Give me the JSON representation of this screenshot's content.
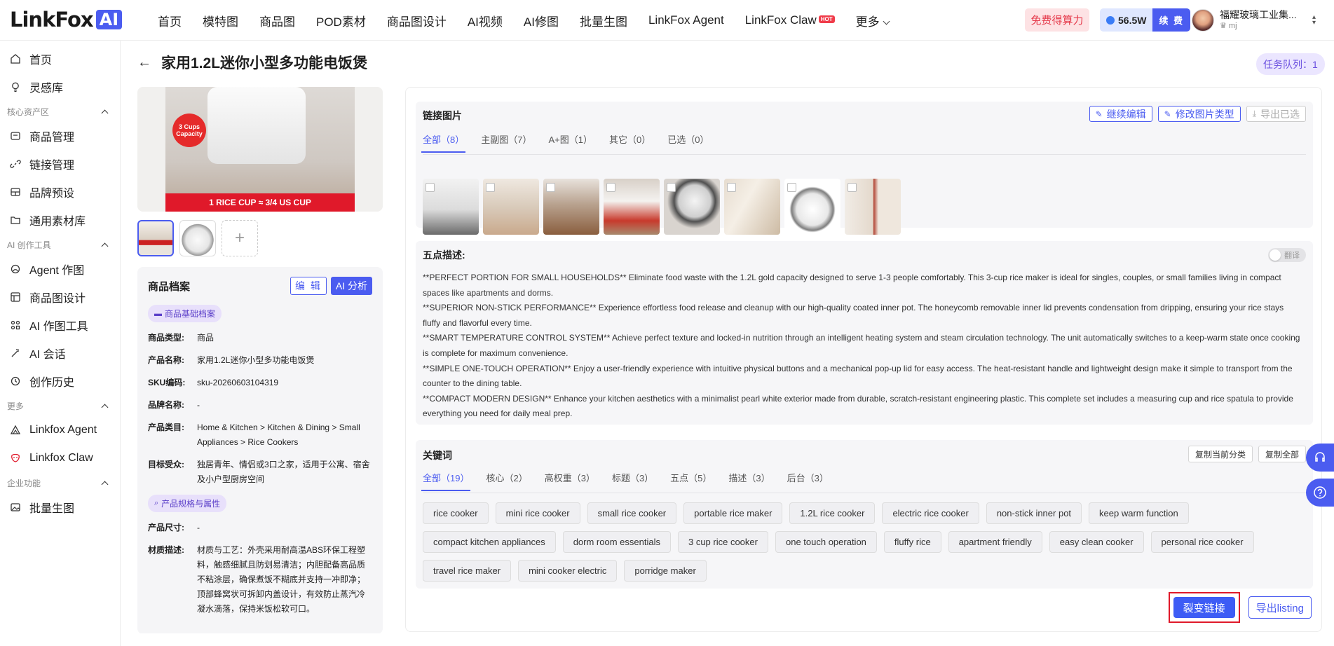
{
  "header": {
    "logo_text": "LinkFox",
    "logo_badge": "AI",
    "nav": [
      "首页",
      "模特图",
      "商品图",
      "POD素材",
      "商品图设计",
      "AI视频",
      "AI修图",
      "批量生图",
      "LinkFox Agent",
      "LinkFox Claw"
    ],
    "hot_badge": "HOT",
    "more": "更多",
    "free_compute": "免费得算力",
    "credits": "56.5W",
    "renew": "续 费",
    "user_name": "福耀玻璃工业集...",
    "user_role": "mj"
  },
  "sidebar": {
    "top_items": [
      "首页",
      "灵感库"
    ],
    "sections": [
      {
        "title": "核心资产区",
        "items": [
          "商品管理",
          "链接管理",
          "品牌预设",
          "通用素材库"
        ]
      },
      {
        "title": "AI 创作工具",
        "items": [
          "Agent 作图",
          "商品图设计",
          "AI 作图工具",
          "AI 会话",
          "创作历史"
        ]
      },
      {
        "title": "更多",
        "items": [
          "Linkfox Agent",
          "Linkfox Claw"
        ]
      },
      {
        "title": "企业功能",
        "items": [
          "批量生图"
        ]
      }
    ]
  },
  "page": {
    "title": "家用1.2L迷你小型多功能电饭煲",
    "queue": "任务队列：1"
  },
  "hero": {
    "badge": "3 Cups Capacity",
    "band": "1 RICE CUP ≈ 3/4 US CUP"
  },
  "profile": {
    "title": "商品档案",
    "edit": "编 辑",
    "ai": "AI 分析",
    "basic_chip": "商品基础档案",
    "rows": [
      {
        "k": "商品类型:",
        "v": "商品"
      },
      {
        "k": "产品名称:",
        "v": "家用1.2L迷你小型多功能电饭煲"
      },
      {
        "k": "SKU编码:",
        "v": "sku-20260603104319"
      },
      {
        "k": "品牌名称:",
        "v": "-"
      },
      {
        "k": "产品类目:",
        "v": "Home & Kitchen > Kitchen & Dining > Small Appliances > Rice Cookers"
      },
      {
        "k": "目标受众:",
        "v": "独居青年、情侣或3口之家，适用于公寓、宿舍及小户型厨房空间"
      }
    ],
    "spec_chip": "产品规格与属性",
    "rows2": [
      {
        "k": "产品尺寸:",
        "v": "-"
      },
      {
        "k": "材质描述:",
        "v": "材质与工艺：外壳采用耐高温ABS环保工程塑料，触感细腻且防划易清洁；内胆配备高品质不粘涂层，确保煮饭不糊底并支持一冲即净；顶部蜂窝状可拆卸内盖设计，有效防止蒸汽冷凝水滴落，保持米饭松软可口。"
      }
    ]
  },
  "link_images": {
    "title": "链接图片",
    "actions": [
      "继续编辑",
      "修改图片类型",
      "导出已选"
    ],
    "tabs": [
      "全部（8）",
      "主副图（7）",
      "A+图（1）",
      "其它（0）",
      "已选（0）"
    ]
  },
  "five_points": {
    "title": "五点描述:",
    "toggle": "翻译",
    "lines": [
      "**PERFECT PORTION FOR SMALL HOUSEHOLDS** Eliminate food waste with the 1.2L gold capacity designed to serve 1-3 people comfortably. This 3-cup rice maker is ideal for singles, couples, or small families living in compact spaces like apartments and dorms.",
      "**SUPERIOR NON-STICK PERFORMANCE** Experience effortless food release and cleanup with our high-quality coated inner pot. The honeycomb removable inner lid prevents condensation from dripping, ensuring your rice stays fluffy and flavorful every time.",
      "**SMART TEMPERATURE CONTROL SYSTEM** Achieve perfect texture and locked-in nutrition through an intelligent heating system and steam circulation technology. The unit automatically switches to a keep-warm state once cooking is complete for maximum convenience.",
      "**SIMPLE ONE-TOUCH OPERATION** Enjoy a user-friendly experience with intuitive physical buttons and a mechanical pop-up lid for easy access. The heat-resistant handle and lightweight design make it simple to transport from the counter to the dining table.",
      "**COMPACT MODERN DESIGN** Enhance your kitchen aesthetics with a minimalist pearl white exterior made from durable, scratch-resistant engineering plastic. This complete set includes a measuring cup and rice spatula to provide everything you need for daily meal prep."
    ]
  },
  "keywords": {
    "title": "关键词",
    "copy_current": "复制当前分类",
    "copy_all": "复制全部",
    "tabs": [
      "全部（19）",
      "核心（2）",
      "高权重（3）",
      "标题（3）",
      "五点（5）",
      "描述（3）",
      "后台（3）"
    ],
    "items": [
      "rice cooker",
      "mini rice cooker",
      "small rice cooker",
      "portable rice maker",
      "1.2L rice cooker",
      "electric rice cooker",
      "non-stick inner pot",
      "keep warm function",
      "compact kitchen appliances",
      "dorm room essentials",
      "3 cup rice cooker",
      "one touch operation",
      "fluffy rice",
      "apartment friendly",
      "easy clean cooker",
      "personal rice cooker",
      "travel rice maker",
      "mini cooker electric",
      "porridge maker"
    ]
  },
  "footer_actions": {
    "fission": "裂变链接",
    "export": "导出listing"
  }
}
